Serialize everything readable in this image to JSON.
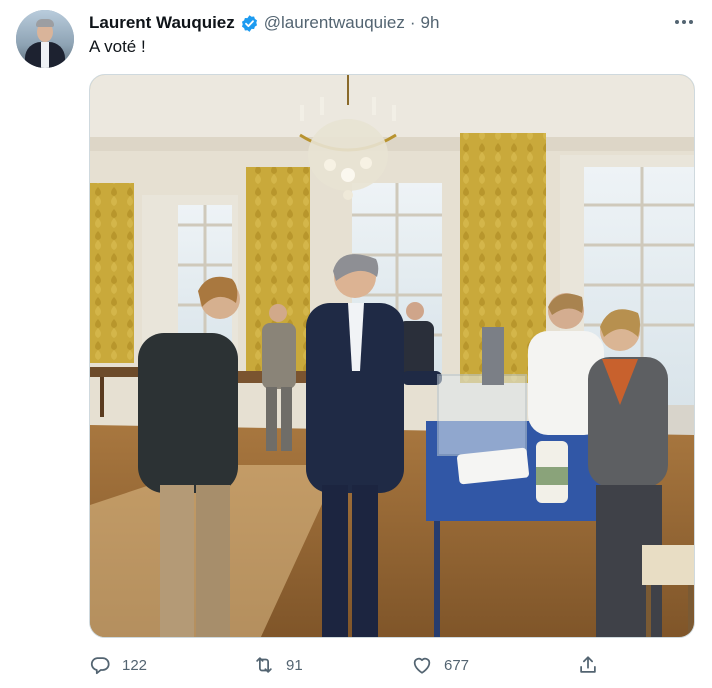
{
  "tweet": {
    "author_name": "Laurent Wauquiez",
    "handle": "@laurentwauquiez",
    "separator": "·",
    "timestamp": "9h",
    "text": "A voté !",
    "verified": true,
    "accent_color": "#1d9bf0"
  },
  "actions": {
    "reply_count": "122",
    "retweet_count": "91",
    "like_count": "677",
    "icons": [
      "reply-icon",
      "retweet-icon",
      "like-icon",
      "share-icon"
    ]
  },
  "media": {
    "kind": "photo"
  }
}
